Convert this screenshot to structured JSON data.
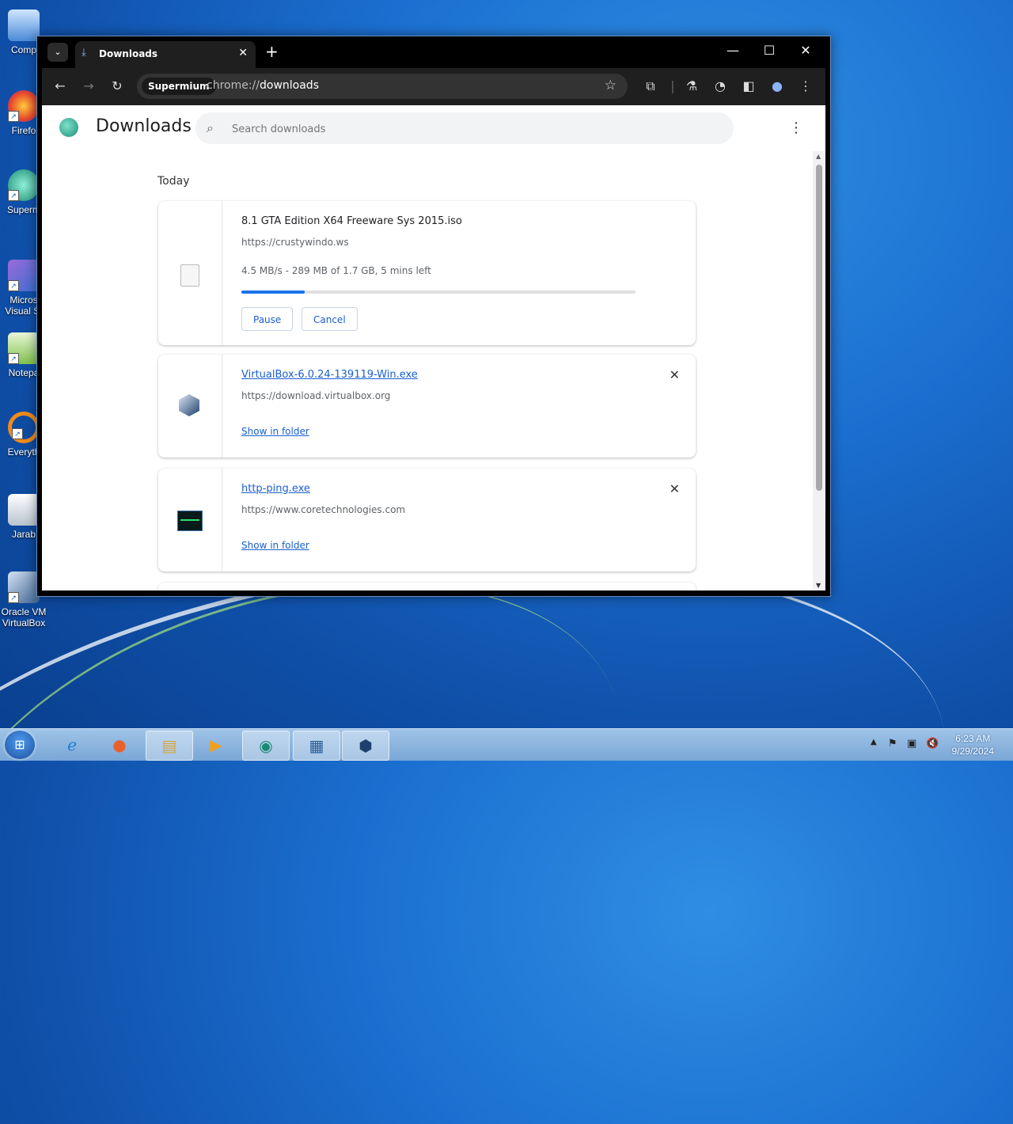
{
  "desktop": {
    "icons": [
      {
        "label": "Comp"
      },
      {
        "label": "Firefo"
      },
      {
        "label": "Superm"
      },
      {
        "label": "Micros Visual St"
      },
      {
        "label": "Notepa"
      },
      {
        "label": "Everyth"
      },
      {
        "label": "Jarab"
      },
      {
        "label": "Oracle VM VirtualBox"
      }
    ]
  },
  "browser": {
    "tab_dropdown_icon": "chevron-down-icon",
    "tab": {
      "title": "Downloads",
      "icon": "download-icon"
    },
    "new_tab": "+",
    "address": {
      "chip": "Supermium",
      "url_scheme": "chrome://",
      "url_path": "downloads"
    }
  },
  "downloads_page": {
    "title": "Downloads",
    "search": {
      "placeholder": "Search downloads"
    },
    "section": "Today",
    "items": [
      {
        "filename": "8.1 GTA Edition X64 Freeware Sys 2015.iso",
        "source": "https://crustywindo.ws",
        "status": "4.5 MB/s - 289 MB of 1.7 GB, 5 mins left",
        "progress_percent": 16,
        "buttons": {
          "pause": "Pause",
          "cancel": "Cancel"
        }
      },
      {
        "filename": "VirtualBox-6.0.24-139119-Win.exe",
        "source": "https://download.virtualbox.org",
        "action": "Show in folder"
      },
      {
        "filename": "http-ping.exe",
        "source": "https://www.coretechnologies.com",
        "action": "Show in folder"
      }
    ]
  },
  "taskbar": {
    "clock": {
      "time": "6:23 AM",
      "date": "9/29/2024"
    }
  }
}
